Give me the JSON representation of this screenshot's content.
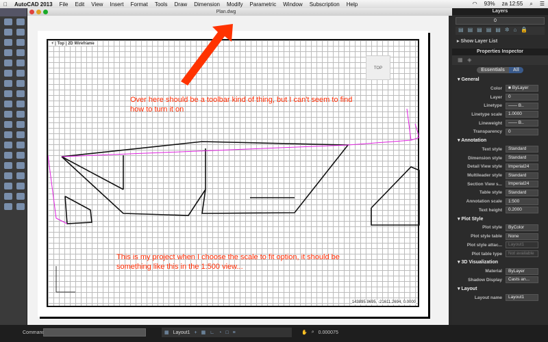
{
  "menubar": {
    "app": "AutoCAD 2013",
    "items": [
      "File",
      "Edit",
      "View",
      "Insert",
      "Format",
      "Tools",
      "Draw",
      "Dimension",
      "Modify",
      "Parametric",
      "Window",
      "Subscription",
      "Help"
    ],
    "battery": "93%",
    "clock": "za 12:55"
  },
  "window": {
    "title": "Plan.dwg"
  },
  "viewport": {
    "label": "+ | Top | 2D Wireframe",
    "viewcube": "TOP",
    "coords": "143895.9695, -21611.2694, 0.0000"
  },
  "annotations": {
    "top": "Over here should be a toolbar kind of thing, but I can't seem to find how to turn it on",
    "bottom": "This is my project when I choose the scale to fit option, it should be something like this in the 1:500 view..."
  },
  "layers": {
    "title": "Layers",
    "current": "0",
    "show_list": "Show Layer List"
  },
  "props": {
    "title": "Properties Inspector",
    "tabs": [
      "Essentials",
      "All"
    ],
    "sections": [
      {
        "name": "General",
        "rows": [
          [
            "Color",
            "■ ByLayer"
          ],
          [
            "Layer",
            "0"
          ],
          [
            "Linetype",
            "—— B.."
          ],
          [
            "Linetype scale",
            "1.0000"
          ],
          [
            "Lineweight",
            "—— B.."
          ],
          [
            "Transparency",
            "0"
          ]
        ]
      },
      {
        "name": "Annotation",
        "rows": [
          [
            "Text style",
            "Standard"
          ],
          [
            "Dimension style",
            "Standard"
          ],
          [
            "Detail View style",
            "Imperial24"
          ],
          [
            "Multileader style",
            "Standard"
          ],
          [
            "Section View s...",
            "Imperial24"
          ],
          [
            "Table style",
            "Standard"
          ],
          [
            "Annotation scale",
            "1:500"
          ],
          [
            "Text height",
            "0.2000"
          ]
        ]
      },
      {
        "name": "Plot Style",
        "rows": [
          [
            "Plot style",
            "ByColor"
          ],
          [
            "Plot style table",
            "None"
          ],
          [
            "Plot style attac...",
            "Layout1"
          ],
          [
            "Plot table type",
            "Not available"
          ]
        ]
      },
      {
        "name": "3D Visualization",
        "rows": [
          [
            "Material",
            "ByLayer"
          ],
          [
            "Shadow Display",
            "Casts an..."
          ]
        ]
      },
      {
        "name": "Layout",
        "rows": [
          [
            "Layout name",
            "Layout1"
          ]
        ]
      }
    ]
  },
  "statusbar": {
    "command_label": "Command:",
    "layout": "Layout1",
    "scale": "0.000075"
  }
}
